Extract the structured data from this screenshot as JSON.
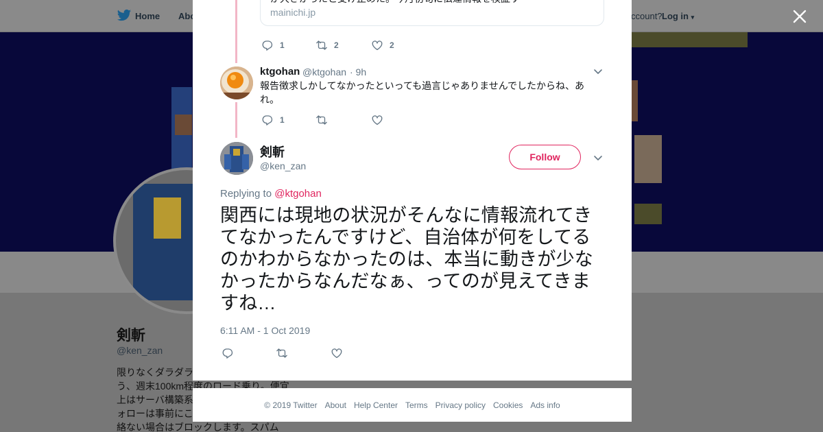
{
  "background": {
    "nav": {
      "home": "Home",
      "about": "Abo",
      "account": "ccount?",
      "login": "Log in"
    },
    "profile": {
      "name": "剣斬",
      "handle": "@ken_zan",
      "bio_lines": [
        "限りなくダラダラ",
        "う、週末100km程度のロード乗り。便宜",
        "上はサーバ構築系",
        "ォローは事前にこ",
        "絡ない場合はブロックします。スパム"
      ]
    }
  },
  "modal": {
    "prev_card": {
      "snippet": "が大きかったと受け止めた。今月初旬に伝達情報を検証す",
      "domain": "mainichi.jp"
    },
    "prev_actions": {
      "reply_count": "1",
      "retweet_count": "2",
      "like_count": "2"
    },
    "reply_tweet": {
      "name": "ktgohan",
      "handle": "@ktgohan",
      "time": "· 9h",
      "text": "報告徴求しかしてなかったといっても過言じゃありませんでしたからね、あれ。",
      "reply_count": "1"
    },
    "main_tweet": {
      "name": "剣斬",
      "handle": "@ken_zan",
      "follow_label": "Follow",
      "replying_prefix": "Replying to",
      "replying_to": "@ktgohan",
      "text": "関西には現地の状況がそんなに情報流れてきてなかったんですけど、自治体が何をしてるのかわからなかったのは、本当に動きが少なかったからなんだなぁ、ってのが見えてきますね…",
      "timestamp": "6:11 AM - 1 Oct 2019"
    }
  },
  "footer": {
    "links": [
      "© 2019 Twitter",
      "About",
      "Help Center",
      "Terms",
      "Privacy policy",
      "Cookies",
      "Ads info"
    ]
  },
  "colors": {
    "accent": "#e0245e",
    "thread_line": "#f2b6c6",
    "secondary_text": "#657786",
    "overlay": "#7a7a7a"
  },
  "icons": [
    "twitter-bird-icon",
    "reply-icon",
    "retweet-icon",
    "like-icon",
    "chevron-down-icon",
    "close-icon"
  ]
}
